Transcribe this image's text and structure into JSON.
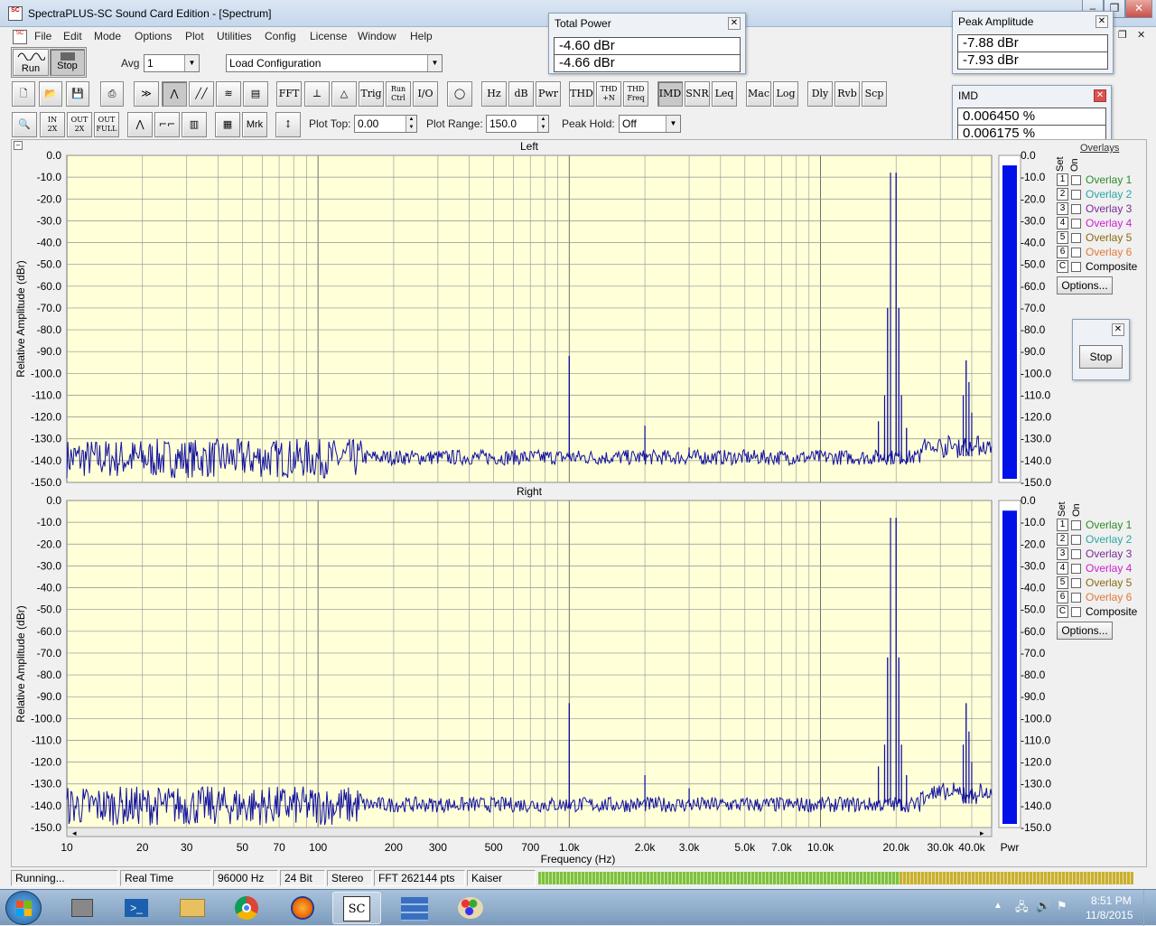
{
  "window": {
    "title": "SpectraPLUS-SC Sound Card Edition - [Spectrum]",
    "app_icon_text": "SC",
    "controls": [
      "–",
      "❐",
      "✕"
    ],
    "mdi_controls": [
      "–",
      "❐",
      "✕"
    ]
  },
  "menu": [
    "File",
    "Edit",
    "Mode",
    "Options",
    "Plot",
    "Utilities",
    "Config",
    "License",
    "Window",
    "Help"
  ],
  "toolbar1": {
    "run_label": "Run",
    "stop_label": "Stop",
    "avg_label": "Avg",
    "avg_value": "1",
    "load_config": "Load Configuration"
  },
  "toolbar2": [
    "FFT",
    "Trig",
    "Run Ctrl",
    "I/O",
    "Hz",
    "dB",
    "Pwr",
    "THD",
    "THD +N",
    "THD Freq",
    "IMD",
    "SNR",
    "Leq",
    "Mac",
    "Log",
    "Dly",
    "Rvb",
    "Scp"
  ],
  "toolbar3": {
    "zoom_buttons": [
      "OUT 2X",
      "OUT 2X",
      "OUT FULL"
    ],
    "mrk": "Mrk",
    "plot_top_label": "Plot Top:",
    "plot_top_value": "0.00",
    "plot_range_label": "Plot Range:",
    "plot_range_value": "150.0",
    "peak_hold_label": "Peak Hold:",
    "peak_hold_value": "Off"
  },
  "popups": {
    "total_power": {
      "title": "Total Power",
      "values": [
        "-4.60 dBr",
        "-4.66 dBr"
      ]
    },
    "peak_amplitude": {
      "title": "Peak Amplitude",
      "values": [
        "-7.88 dBr",
        "-7.93 dBr"
      ]
    },
    "imd": {
      "title": "IMD",
      "values": [
        "0.006450 %",
        "0.006175 %"
      ]
    },
    "stop": {
      "button": "Stop"
    }
  },
  "overlays": {
    "header": "Overlays",
    "set_label": "Set",
    "on_label": "On",
    "items": [
      {
        "num": "1",
        "label": "Overlay 1",
        "color": "#2e8b2e"
      },
      {
        "num": "2",
        "label": "Overlay 2",
        "color": "#2aa6a6"
      },
      {
        "num": "3",
        "label": "Overlay 3",
        "color": "#7a2a9a"
      },
      {
        "num": "4",
        "label": "Overlay 4",
        "color": "#d020d0"
      },
      {
        "num": "5",
        "label": "Overlay 5",
        "color": "#8a6a10"
      },
      {
        "num": "6",
        "label": "Overlay 6",
        "color": "#e07a3a"
      },
      {
        "num": "C",
        "label": "Composite",
        "color": "#000000"
      }
    ],
    "options_button": "Options..."
  },
  "chart_data": [
    {
      "type": "line",
      "title": "Left",
      "ylabel": "Relative Amplitude (dBr)",
      "xlabel": "Frequency (Hz)",
      "xscale": "log",
      "xlim": [
        10,
        48000
      ],
      "ylim": [
        -150,
        0
      ],
      "grid": true,
      "series_color": "#1010a0",
      "noise_floor": -138,
      "peaks": [
        {
          "f": 1000,
          "db": -92
        },
        {
          "f": 2000,
          "db": -124
        },
        {
          "f": 3000,
          "db": -134
        },
        {
          "f": 17000,
          "db": -122
        },
        {
          "f": 18000,
          "db": -110
        },
        {
          "f": 18500,
          "db": -70
        },
        {
          "f": 19000,
          "db": -8
        },
        {
          "f": 20000,
          "db": -8
        },
        {
          "f": 20500,
          "db": -70
        },
        {
          "f": 21000,
          "db": -110
        },
        {
          "f": 22000,
          "db": -125
        },
        {
          "f": 37000,
          "db": -110
        },
        {
          "f": 38000,
          "db": -94
        },
        {
          "f": 39000,
          "db": -104
        },
        {
          "f": 40000,
          "db": -118
        }
      ],
      "pwr_bar_db": -4.6
    },
    {
      "type": "line",
      "title": "Right",
      "ylabel": "Relative Amplitude (dBr)",
      "xlabel": "Frequency (Hz)",
      "xscale": "log",
      "xlim": [
        10,
        48000
      ],
      "ylim": [
        -150,
        0
      ],
      "grid": true,
      "series_color": "#1010a0",
      "noise_floor": -139,
      "peaks": [
        {
          "f": 1000,
          "db": -93
        },
        {
          "f": 2000,
          "db": -126
        },
        {
          "f": 3000,
          "db": -132
        },
        {
          "f": 17000,
          "db": -122
        },
        {
          "f": 18000,
          "db": -112
        },
        {
          "f": 18500,
          "db": -72
        },
        {
          "f": 19000,
          "db": -8
        },
        {
          "f": 20000,
          "db": -8
        },
        {
          "f": 20500,
          "db": -72
        },
        {
          "f": 21000,
          "db": -112
        },
        {
          "f": 22000,
          "db": -126
        },
        {
          "f": 37000,
          "db": -112
        },
        {
          "f": 38000,
          "db": -93
        },
        {
          "f": 39000,
          "db": -106
        },
        {
          "f": 40000,
          "db": -120
        }
      ],
      "pwr_bar_db": -4.66
    }
  ],
  "axes": {
    "y_ticks": [
      "0.0",
      "-10.0",
      "-20.0",
      "-30.0",
      "-40.0",
      "-50.0",
      "-60.0",
      "-70.0",
      "-80.0",
      "-90.0",
      "-100.0",
      "-110.0",
      "-120.0",
      "-130.0",
      "-140.0",
      "-150.0"
    ],
    "x_ticks": [
      {
        "f": 10,
        "label": "10"
      },
      {
        "f": 20,
        "label": "20"
      },
      {
        "f": 30,
        "label": "30"
      },
      {
        "f": 50,
        "label": "50"
      },
      {
        "f": 70,
        "label": "70"
      },
      {
        "f": 100,
        "label": "100"
      },
      {
        "f": 200,
        "label": "200"
      },
      {
        "f": 300,
        "label": "300"
      },
      {
        "f": 500,
        "label": "500"
      },
      {
        "f": 700,
        "label": "700"
      },
      {
        "f": 1000,
        "label": "1.0k"
      },
      {
        "f": 2000,
        "label": "2.0k"
      },
      {
        "f": 3000,
        "label": "3.0k"
      },
      {
        "f": 5000,
        "label": "5.0k"
      },
      {
        "f": 7000,
        "label": "7.0k"
      },
      {
        "f": 10000,
        "label": "10.0k"
      },
      {
        "f": 20000,
        "label": "20.0k"
      },
      {
        "f": 30000,
        "label": "30.0k"
      },
      {
        "f": 40000,
        "label": "40.0k"
      }
    ],
    "pwr_label": "Pwr"
  },
  "status": [
    "Running...",
    "Real Time",
    "96000 Hz",
    "24 Bit",
    "Stereo",
    "FFT 262144 pts",
    "Kaiser"
  ],
  "taskbar": {
    "time": "8:51 PM",
    "date": "11/8/2015"
  }
}
